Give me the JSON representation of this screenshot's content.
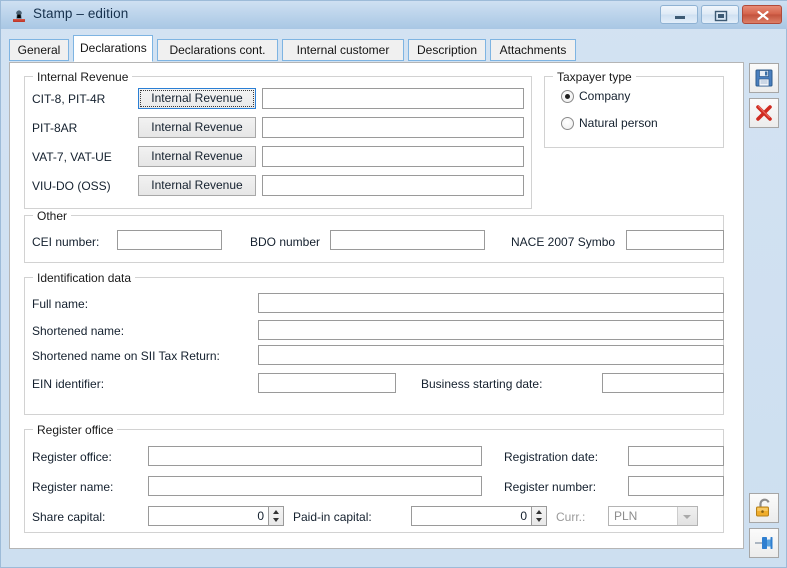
{
  "window": {
    "title": "Stamp – edition",
    "icon": "stamp-icon",
    "minimize_label": "Minimize",
    "maximize_label": "Restore",
    "close_label": "Close"
  },
  "tabs": [
    {
      "label": "General",
      "selected": false
    },
    {
      "label": "Declarations",
      "selected": true
    },
    {
      "label": "Declarations cont.",
      "selected": false
    },
    {
      "label": "Internal customer",
      "selected": false
    },
    {
      "label": "Description",
      "selected": false
    },
    {
      "label": "Attachments",
      "selected": false
    }
  ],
  "internal_revenue": {
    "title": "Internal Revenue",
    "rows": [
      {
        "label": "CIT-8, PIT-4R",
        "button": "Internal Revenue",
        "value": "",
        "focused": true
      },
      {
        "label": "PIT-8AR",
        "button": "Internal Revenue",
        "value": "",
        "focused": false
      },
      {
        "label": "VAT-7, VAT-UE",
        "button": "Internal Revenue",
        "value": "",
        "focused": false
      },
      {
        "label": "VIU-DO (OSS)",
        "button": "Internal Revenue",
        "value": "",
        "focused": false
      }
    ]
  },
  "taxpayer_type": {
    "title": "Taxpayer type",
    "options": [
      {
        "label": "Company",
        "selected": true
      },
      {
        "label": "Natural person",
        "selected": false
      }
    ]
  },
  "other": {
    "title": "Other",
    "cei_label": "CEI number:",
    "cei_value": "",
    "bdo_label": "BDO number",
    "bdo_value": "",
    "nace_label": "NACE 2007 Symbo",
    "nace_value": ""
  },
  "identification": {
    "title": "Identification data",
    "full_name_label": "Full name:",
    "full_name_value": "",
    "shortened_name_label": "Shortened name:",
    "shortened_name_value": "",
    "sii_label": "Shortened name on SII Tax Return:",
    "sii_value": "",
    "ein_label": "EIN identifier:",
    "ein_value": "",
    "business_date_label": "Business starting date:",
    "business_date_value": ""
  },
  "register_office": {
    "title": "Register office",
    "office_label": "Register office:",
    "office_value": "",
    "name_label": "Register name:",
    "name_value": "",
    "share_capital_label": "Share capital:",
    "share_capital_value": "0",
    "paid_in_label": "Paid-in capital:",
    "paid_in_value": "0",
    "currency_label": "Curr.:",
    "currency_value": "PLN",
    "registration_date_label": "Registration date:",
    "registration_date_value": "",
    "register_number_label": "Register number:",
    "register_number_value": ""
  },
  "toolbar": {
    "save_label": "Save",
    "cancel_label": "Cancel",
    "unlock_label": "Unlock",
    "pin_label": "Pin"
  },
  "colors": {
    "titlebar": "#b9d2ea",
    "tab_border": "#7eb4e2",
    "close_button": "#c3523c",
    "focus_border": "#2b7fd4",
    "save_icon": "#3a6ea5",
    "cancel_icon": "#cf2a20",
    "unlock_icon": "#e8a321",
    "pin_icon": "#2f7fd0"
  }
}
